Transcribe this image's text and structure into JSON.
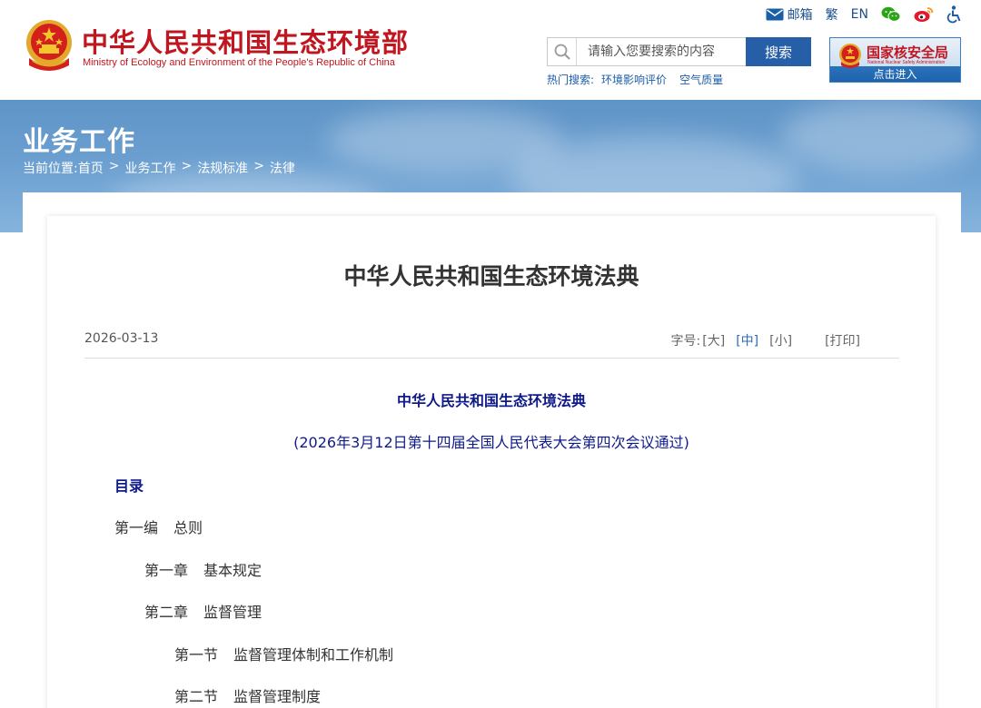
{
  "header": {
    "site_title": "中华人民共和国生态环境部",
    "site_subtitle": "Ministry of Ecology and Environment of the People's Republic of China",
    "top_links": {
      "mail": "邮箱",
      "traditional": "繁",
      "english": "EN"
    },
    "search": {
      "placeholder": "请输入您要搜索的内容",
      "button": "搜索"
    },
    "hot_search": {
      "label": "热门搜索:",
      "links": [
        "环境影响评价",
        "空气质量"
      ]
    },
    "nnsa_banner": {
      "title": "国家核安全局",
      "subtitle": "National Nuclear Safety Administration",
      "enter": "点击进入"
    }
  },
  "hero": {
    "section_title": "业务工作",
    "breadcrumb_label": "当前位置:",
    "breadcrumb": [
      "首页",
      "业务工作",
      "法规标准",
      "法律"
    ],
    "separator": ">"
  },
  "article": {
    "title": "中华人民共和国生态环境法典",
    "date": "2026-03-13",
    "font_size_label": "字号:",
    "font_sizes": [
      "[大]",
      "[中]",
      "[小]"
    ],
    "print": "[打印]",
    "doc_heading": "中华人民共和国生态环境法典",
    "doc_subheading": "(2026年3月12日第十四届全国人民代表大会第四次会议通过)",
    "toc_label": "目录",
    "toc": [
      {
        "num": "第一编",
        "text": "总则"
      },
      {
        "num": "第一章",
        "text": "基本规定"
      },
      {
        "num": "第二章",
        "text": "监督管理"
      },
      {
        "num": "第一节",
        "text": "监督管理体制和工作机制"
      },
      {
        "num": "第二节",
        "text": "监督管理制度"
      }
    ]
  },
  "colors": {
    "brand_red": "#c0161f",
    "accent_blue": "#265fa7",
    "doc_navy": "#0f1a8a"
  }
}
